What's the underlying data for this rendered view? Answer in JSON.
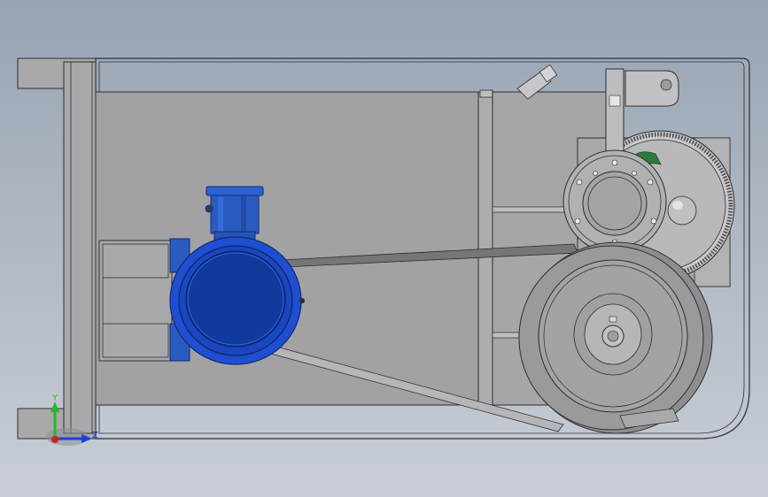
{
  "viewport": {
    "background_top": "#98a4b4",
    "background_bottom": "#c9ced6"
  },
  "model": {
    "colors": {
      "frame_fill": "#a9a9ab",
      "panel_fill": "#a2a2a4",
      "edge": "#2d2d30",
      "motor_blue": "#1f4fd0",
      "motor_blue_dark": "#113a9e",
      "motor_terminal_box": "#2a5cc0",
      "pulley_gray": "#9a9a9c",
      "pulley_dark": "#7c7c7e",
      "belt": "#6f6f72",
      "gear_teeth": "#c9c9cb",
      "accent_green": "#2f7a3a"
    }
  },
  "triad": {
    "y_label": "Y",
    "z_label": "Z",
    "y_color": "#2db42d",
    "z_color": "#1c3ee0",
    "x_color": "#d11f1f"
  }
}
